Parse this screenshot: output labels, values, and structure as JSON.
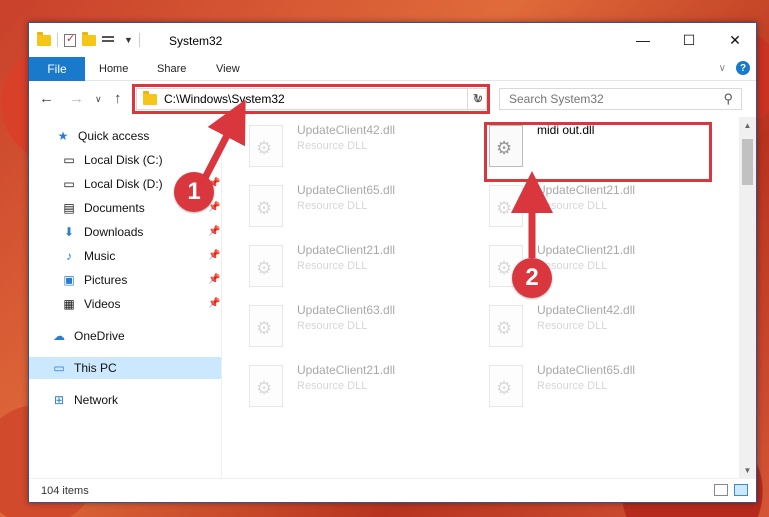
{
  "window": {
    "title": "System32",
    "controls": {
      "minimize": "—",
      "maximize": "☐",
      "close": "✕"
    }
  },
  "ribbon": {
    "tabs": [
      "File",
      "Home",
      "Share",
      "View"
    ]
  },
  "address_bar": {
    "path": "C:\\Windows\\System32"
  },
  "search": {
    "placeholder": "Search System32"
  },
  "sidebar": {
    "items": [
      {
        "label": "Quick access",
        "icon": "star-icon",
        "pinned": false
      },
      {
        "label": "Local Disk (C:)",
        "icon": "drive-icon",
        "pinned": false
      },
      {
        "label": "Local Disk (D:)",
        "icon": "drive-icon",
        "pinned": true
      },
      {
        "label": "Documents",
        "icon": "documents-icon",
        "pinned": true
      },
      {
        "label": "Downloads",
        "icon": "download-icon",
        "pinned": true
      },
      {
        "label": "Music",
        "icon": "music-icon",
        "pinned": true
      },
      {
        "label": "Pictures",
        "icon": "pictures-icon",
        "pinned": true
      },
      {
        "label": "Videos",
        "icon": "videos-icon",
        "pinned": true
      },
      {
        "label": "OneDrive",
        "icon": "cloud-icon",
        "pinned": false
      },
      {
        "label": "This PC",
        "icon": "computer-icon",
        "pinned": false
      },
      {
        "label": "Network",
        "icon": "network-icon",
        "pinned": false
      }
    ]
  },
  "files": [
    {
      "name": "UpdateClient42.dll",
      "type": "Resource DLL"
    },
    {
      "name": "midi out.dll",
      "type": ""
    },
    {
      "name": "UpdateClient65.dll",
      "type": "Resource DLL"
    },
    {
      "name": "UpdateClient21.dll",
      "type": "Resource DLL"
    },
    {
      "name": "UpdateClient21.dll",
      "type": "Resource DLL"
    },
    {
      "name": "UpdateClient21.dll",
      "type": "Resource DLL"
    },
    {
      "name": "UpdateClient63.dll",
      "type": "Resource DLL"
    },
    {
      "name": "UpdateClient42.dll",
      "type": "Resource DLL"
    },
    {
      "name": "UpdateClient21.dll",
      "type": "Resource DLL"
    },
    {
      "name": "UpdateClient65.dll",
      "type": "Resource DLL"
    }
  ],
  "status": {
    "item_count": "104 items"
  },
  "annotations": {
    "badge1": "1",
    "badge2": "2",
    "color": "#d9363e"
  }
}
